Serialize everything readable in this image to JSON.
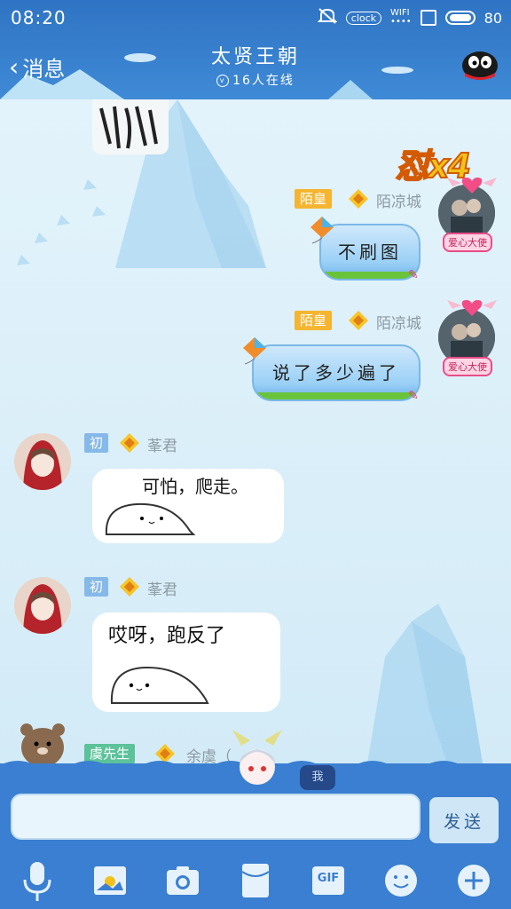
{
  "status_bar": {
    "time": "08:20",
    "clock_label": "clock",
    "wifi_label": "WIFI",
    "battery": "80"
  },
  "header": {
    "back_label": "消息",
    "title": "太贤王朝",
    "online": "16人在线"
  },
  "combo": {
    "label": "怼",
    "count": "x4"
  },
  "messages": [
    {
      "side": "right",
      "title_badge": "陌皇",
      "nickname": "陌凉城",
      "text": "不刷图",
      "avatar_tag": "爱心大使"
    },
    {
      "side": "right",
      "title_badge": "陌皇",
      "nickname": "陌凉城",
      "text": "说了多少遍了",
      "avatar_tag": "爱心大使"
    },
    {
      "side": "left",
      "title_badge": "初",
      "nickname": "莑君",
      "text": "可怕，爬走。"
    },
    {
      "side": "left",
      "title_badge": "初",
      "nickname": "莑君",
      "text": "哎呀，跑反了"
    },
    {
      "side": "left",
      "title_badge": "虞先生",
      "nickname": "余虞（",
      "text": ""
    }
  ],
  "composer": {
    "me_label": "我",
    "input_value": "",
    "send_label": "发送"
  },
  "toolbar": {
    "gif_label": "GIF"
  },
  "colors": {
    "header": "#2f74c4",
    "chat_bg": "#e3f3fb",
    "badge_gold": "#f5b530",
    "badge_blue": "#86b9e8",
    "badge_green": "#5cc29a"
  }
}
